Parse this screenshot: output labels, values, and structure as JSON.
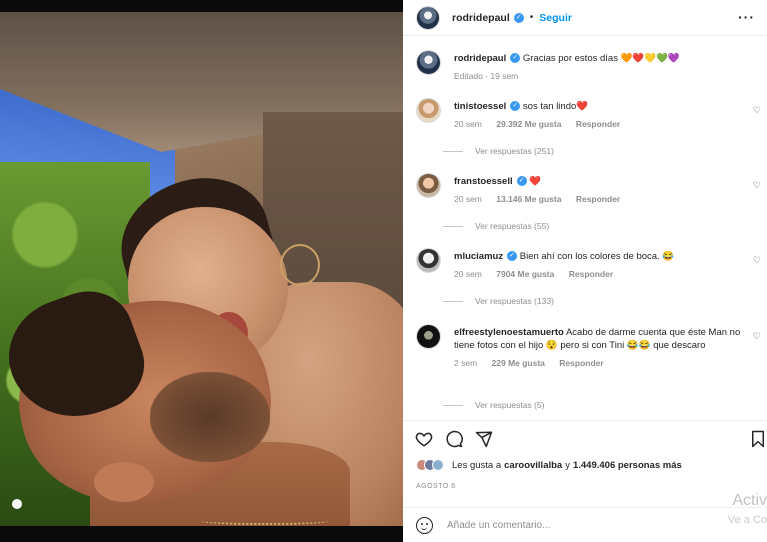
{
  "post": {
    "username": "rodridepaul",
    "follow_label": "Seguir",
    "caption": "Gracias por estos días",
    "caption_emojis": "🧡❤️💛💚💜",
    "edited": "Editado · 19 sem"
  },
  "comments": [
    {
      "user": "tinistoessel",
      "verified": true,
      "text": "sos tan lindo",
      "emoji": "❤️",
      "time": "20 sem",
      "likes": "29.392 Me gusta",
      "reply": "Responder",
      "replies": "Ver respuestas (251)"
    },
    {
      "user": "franstoessell",
      "verified": true,
      "text": "",
      "emoji": "❤️",
      "time": "20 sem",
      "likes": "13.146 Me gusta",
      "reply": "Responder",
      "replies": "Ver respuestas (55)"
    },
    {
      "user": "mluciamuz",
      "verified": true,
      "text": "Bien ahí con los colores de boca.",
      "emoji": "😂",
      "time": "20 sem",
      "likes": "7904 Me gusta",
      "reply": "Responder",
      "replies": "Ver respuestas (133)"
    },
    {
      "user": "elfreestylenoestamuerto",
      "verified": false,
      "text": "Acabo de darme cuenta que éste Man no tiene fotos con el hijo 😯 pero si con Tini 😂😂 que descaro",
      "emoji": "",
      "time": "2 sem",
      "likes": "229 Me gusta",
      "reply": "Responder",
      "replies": "Ver respuestas (5)"
    }
  ],
  "likes": {
    "text_prefix": "Les gusta a ",
    "user": "caroovillalba",
    "text_mid": " y ",
    "count": "1.449.406 personas más"
  },
  "date": "AGOSTO 6",
  "add_comment_placeholder": "Añade un comentario...",
  "watermark": {
    "line1": "Activ",
    "line2": "Ve a Co"
  },
  "icons": {
    "like": "heart-icon",
    "comment": "comment-icon",
    "share": "share-icon",
    "save": "bookmark-icon",
    "more": "more-icon",
    "emoji": "emoji-icon"
  }
}
